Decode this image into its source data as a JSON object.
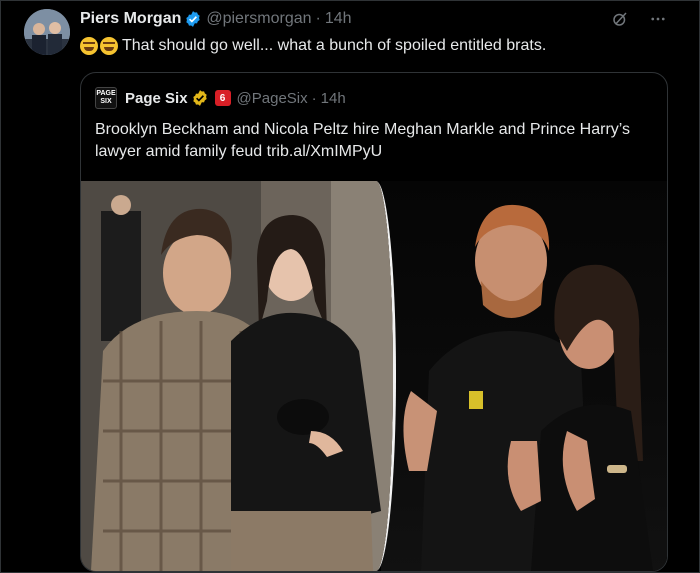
{
  "author": {
    "name": "Piers Morgan",
    "handle": "@piersmorgan",
    "time": "14h"
  },
  "tweet": {
    "emojis": [
      "rolling-on-floor-laughing-icon",
      "rolling-on-floor-laughing-icon"
    ],
    "text": "That should go well... what a bunch of spoiled entitled brats."
  },
  "quoted": {
    "logo_text": "Page Six",
    "name": "Page Six",
    "handle": "@PageSix",
    "time": "14h",
    "text": "Brooklyn Beckham and Nicola Peltz hire Meghan Markle and Prince Harry’s lawyer amid family feud trib.al/XmIMPyU"
  },
  "colors": {
    "background": "#000000",
    "verified_blue": "#1d9bf0",
    "gold_badge": "#e2b719",
    "muted_text": "#71767b"
  }
}
